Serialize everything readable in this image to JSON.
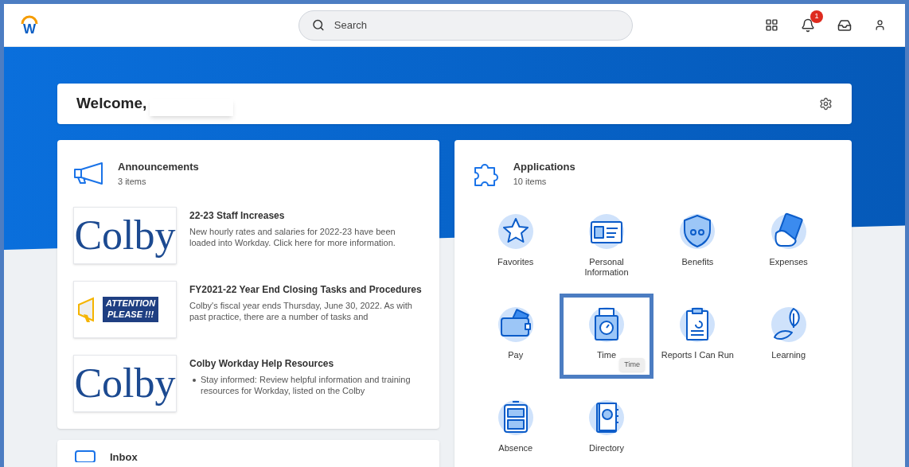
{
  "header": {
    "logo": "W",
    "search": {
      "placeholder": "Search"
    },
    "notifications": {
      "count": "1"
    }
  },
  "welcome": {
    "title": "Welcome,"
  },
  "announcements": {
    "title": "Announcements",
    "count": "3 items",
    "items": [
      {
        "kind": "logo",
        "thumbnail_text": [
          "Colby"
        ],
        "title": "22-23 Staff Increases",
        "body": "New hourly rates and salaries for 2022-23 have been loaded into Workday. Click here for more information.",
        "bullet": false
      },
      {
        "kind": "attention",
        "thumbnail_text": [
          "ATTENTION",
          "PLEASE !!!"
        ],
        "title": "FY2021-22 Year End Closing Tasks and Procedures",
        "body": "Colby's fiscal year ends Thursday, June 30, 2022. As with past practice, there are a number of tasks and",
        "bullet": false
      },
      {
        "kind": "logo",
        "thumbnail_text": [
          "Colby"
        ],
        "title": "Colby Workday Help Resources",
        "body": "Stay informed: Review helpful information and training resources for Workday, listed on the Colby",
        "bullet": true
      }
    ]
  },
  "applications": {
    "title": "Applications",
    "count": "10 items",
    "items": [
      {
        "kind": "star",
        "label": "Favorites",
        "selected": false
      },
      {
        "kind": "card",
        "label": "Personal Information",
        "selected": false
      },
      {
        "kind": "shield",
        "label": "Benefits",
        "selected": false
      },
      {
        "kind": "money",
        "label": "Expenses",
        "selected": false
      },
      {
        "kind": "wallet",
        "label": "Pay",
        "selected": false
      },
      {
        "kind": "clock",
        "label": "Time",
        "selected": true,
        "tooltip": "Time"
      },
      {
        "kind": "clipboard",
        "label": "Reports I Can Run",
        "selected": false
      },
      {
        "kind": "leaf",
        "label": "Learning",
        "selected": false
      },
      {
        "kind": "cabinet",
        "label": "Absence",
        "selected": false
      },
      {
        "kind": "book",
        "label": "Directory",
        "selected": false
      }
    ]
  },
  "inbox": {
    "title": "Inbox"
  }
}
